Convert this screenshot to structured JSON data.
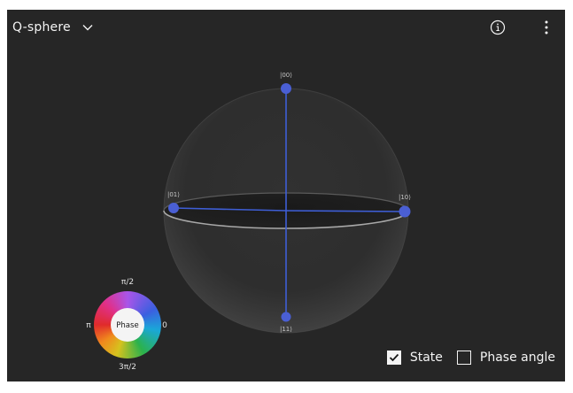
{
  "header": {
    "title": "Q-sphere",
    "title_icon": "chevron-down-icon",
    "info_icon": "info-icon",
    "menu_icon": "overflow-menu-vertical-icon"
  },
  "qsphere": {
    "states": [
      {
        "label": "|00⟩"
      },
      {
        "label": "|01⟩"
      },
      {
        "label": "|10⟩"
      },
      {
        "label": "|11⟩"
      }
    ],
    "vector_color": "#3e5ed6",
    "node_color": "#4a5fd4"
  },
  "phase_wheel": {
    "center_label": "Phase",
    "top_label": "π/2",
    "left_label": "π",
    "right_label": "0",
    "bottom_label": "3π/2"
  },
  "controls": {
    "state": {
      "label": "State",
      "checked": true
    },
    "phase_angle": {
      "label": "Phase angle",
      "checked": false
    }
  },
  "colors": {
    "panel_bg": "#262626",
    "text": "#f4f4f4"
  }
}
